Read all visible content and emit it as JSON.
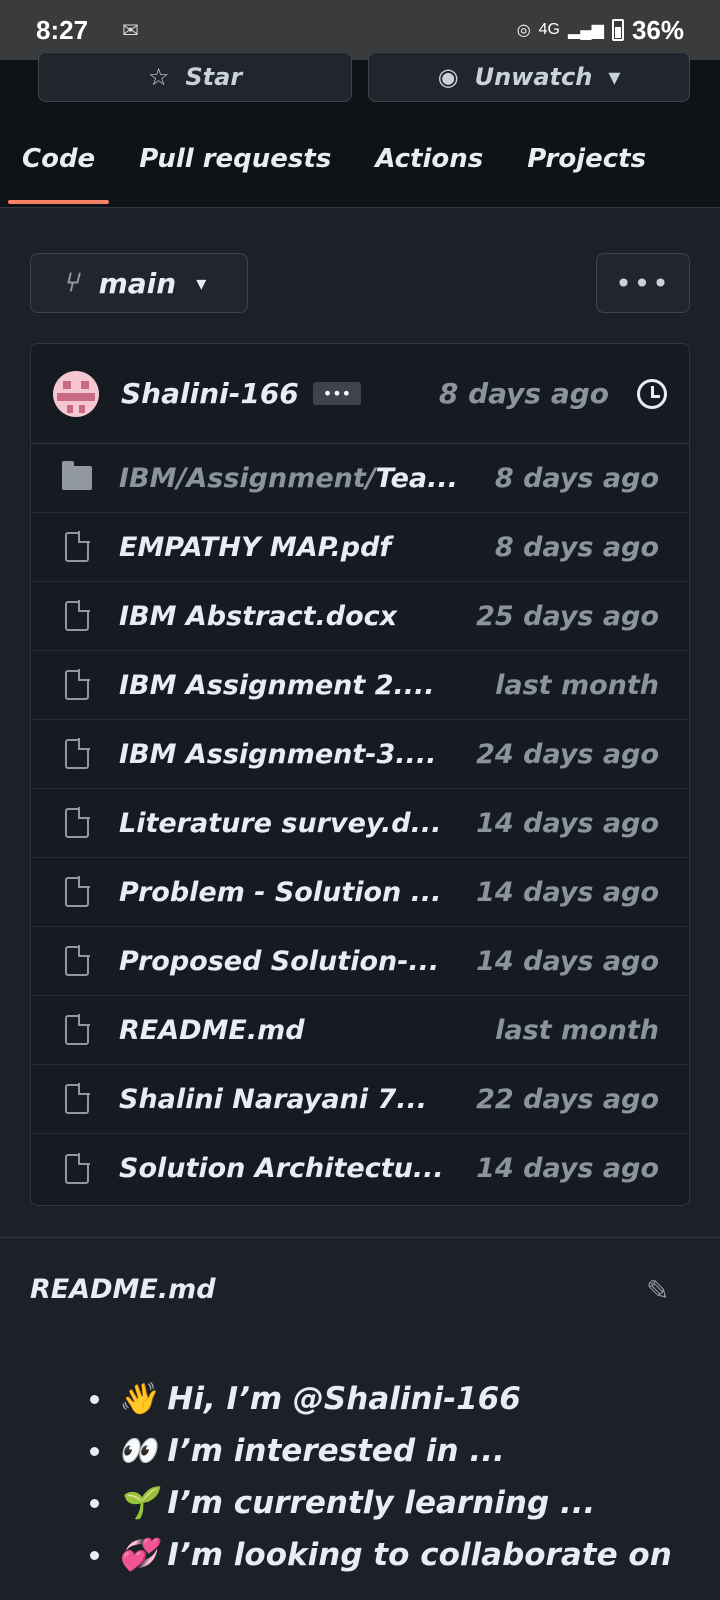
{
  "status_bar": {
    "time": "8:27",
    "network": "4G",
    "battery": "36%"
  },
  "repo_actions": {
    "star_label": "Star",
    "watch_label": "Unwatch"
  },
  "tabs": [
    {
      "label": "Code",
      "active": true
    },
    {
      "label": "Pull requests",
      "active": false
    },
    {
      "label": "Actions",
      "active": false
    },
    {
      "label": "Projects",
      "active": false
    }
  ],
  "branch": {
    "name": "main",
    "more_label": "•••"
  },
  "latest_commit": {
    "user": "Shalini-166",
    "dots": "•••",
    "time": "8 days ago"
  },
  "files": [
    {
      "type": "folder",
      "path_prefix": "IBM/Assignment/",
      "name": "Tea...",
      "time": "8 days ago"
    },
    {
      "type": "file",
      "path_prefix": "",
      "name": "EMPATHY MAP.pdf",
      "time": "8 days ago"
    },
    {
      "type": "file",
      "path_prefix": "",
      "name": "IBM Abstract.docx",
      "time": "25 days ago"
    },
    {
      "type": "file",
      "path_prefix": "",
      "name": "IBM Assignment 2....",
      "time": "last month"
    },
    {
      "type": "file",
      "path_prefix": "",
      "name": "IBM Assignment-3....",
      "time": "24 days ago"
    },
    {
      "type": "file",
      "path_prefix": "",
      "name": "Literature survey.d...",
      "time": "14 days ago"
    },
    {
      "type": "file",
      "path_prefix": "",
      "name": "Problem - Solution ...",
      "time": "14 days ago"
    },
    {
      "type": "file",
      "path_prefix": "",
      "name": "Proposed Solution-...",
      "time": "14 days ago"
    },
    {
      "type": "file",
      "path_prefix": "",
      "name": "README.md",
      "time": "last month"
    },
    {
      "type": "file",
      "path_prefix": "",
      "name": "Shalini Narayani 7...",
      "time": "22 days ago"
    },
    {
      "type": "file",
      "path_prefix": "",
      "name": "Solution Architectu...",
      "time": "14 days ago"
    }
  ],
  "readme": {
    "title": "README.md",
    "items": [
      "👋 Hi, I’m @Shalini-166",
      "👀 I’m interested in ...",
      "🌱 I’m currently learning ...",
      "💞️ I’m looking to collaborate on ..."
    ]
  }
}
